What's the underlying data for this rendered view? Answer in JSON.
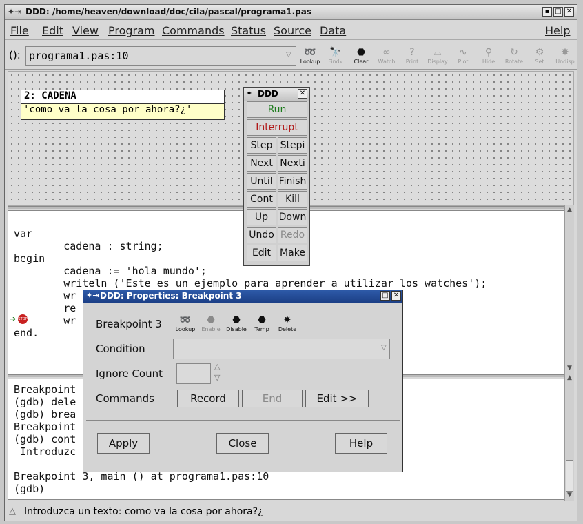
{
  "window": {
    "title": "DDD: /home/heaven/download/doc/cila/pascal/programa1.pas"
  },
  "menubar": {
    "items": [
      "File",
      "Edit",
      "View",
      "Program",
      "Commands",
      "Status",
      "Source",
      "Data"
    ],
    "help": "Help"
  },
  "argbar": {
    "label": "():",
    "value": "programa1.pas:10",
    "tools": [
      {
        "label": "Lookup",
        "icon": "lookup-icon",
        "active": true
      },
      {
        "label": "Find»",
        "icon": "find-icon",
        "active": false
      },
      {
        "label": "Clear",
        "icon": "clear-icon",
        "active": true
      },
      {
        "label": "Watch",
        "icon": "watch-icon",
        "active": false
      },
      {
        "label": "Print",
        "icon": "print-icon",
        "active": false
      },
      {
        "label": "Display",
        "icon": "display-icon",
        "active": false
      },
      {
        "label": "Plot",
        "icon": "plot-icon",
        "active": false
      },
      {
        "label": "Hide",
        "icon": "hide-icon",
        "active": false
      },
      {
        "label": "Rotate",
        "icon": "rotate-icon",
        "active": false
      },
      {
        "label": "Set",
        "icon": "set-icon",
        "active": false
      },
      {
        "label": "Undisp",
        "icon": "undisp-icon",
        "active": false
      }
    ]
  },
  "display": {
    "header": "2: CADENA",
    "value": "'como va la cosa por ahora?¿'"
  },
  "source": {
    "lines": [
      "",
      "var",
      "        cadena : string;",
      "begin",
      "        cadena := 'hola mundo';",
      "        writeln ('Este es un ejemplo para aprender a utilizar los watches');",
      "        wr",
      "        re",
      "        wr",
      "end."
    ]
  },
  "gdb": {
    "lines": [
      "Breakpoint",
      "(gdb) dele",
      "(gdb) brea",
      "Breakpoint",
      "(gdb) cont",
      " Introduzc",
      "",
      "Breakpoint 3, main () at programa1.pas:10",
      "(gdb)"
    ]
  },
  "status": {
    "text": "Introduzca un texto: como va la cosa por ahora?¿"
  },
  "command_tool": {
    "title": "DDD",
    "run": "Run",
    "interrupt": "Interrupt",
    "buttons": [
      [
        "Step",
        "Stepi"
      ],
      [
        "Next",
        "Nexti"
      ],
      [
        "Until",
        "Finish"
      ],
      [
        "Cont",
        "Kill"
      ],
      [
        "Up",
        "Down"
      ],
      [
        "Undo",
        "Redo"
      ],
      [
        "Edit",
        "Make"
      ]
    ],
    "colors": {
      "run": "#1a7a1a",
      "interrupt": "#b01818",
      "disabled": "#8a8a8a"
    }
  },
  "properties": {
    "title": "DDD: Properties: Breakpoint 3",
    "breakpoint_label": "Breakpoint 3",
    "icons": [
      {
        "label": "Lookup",
        "icon": "lookup-icon",
        "enabled": true
      },
      {
        "label": "Enable",
        "icon": "enable-icon",
        "enabled": false
      },
      {
        "label": "Disable",
        "icon": "disable-icon",
        "enabled": true
      },
      {
        "label": "Temp",
        "icon": "temp-icon",
        "enabled": true
      },
      {
        "label": "Delete",
        "icon": "delete-icon",
        "enabled": true
      }
    ],
    "condition_label": "Condition",
    "condition_value": "",
    "ignore_label": "Ignore Count",
    "ignore_value": "",
    "commands_label": "Commands",
    "record": "Record",
    "end": "End",
    "edit": "Edit >>",
    "apply": "Apply",
    "close": "Close",
    "help": "Help"
  }
}
